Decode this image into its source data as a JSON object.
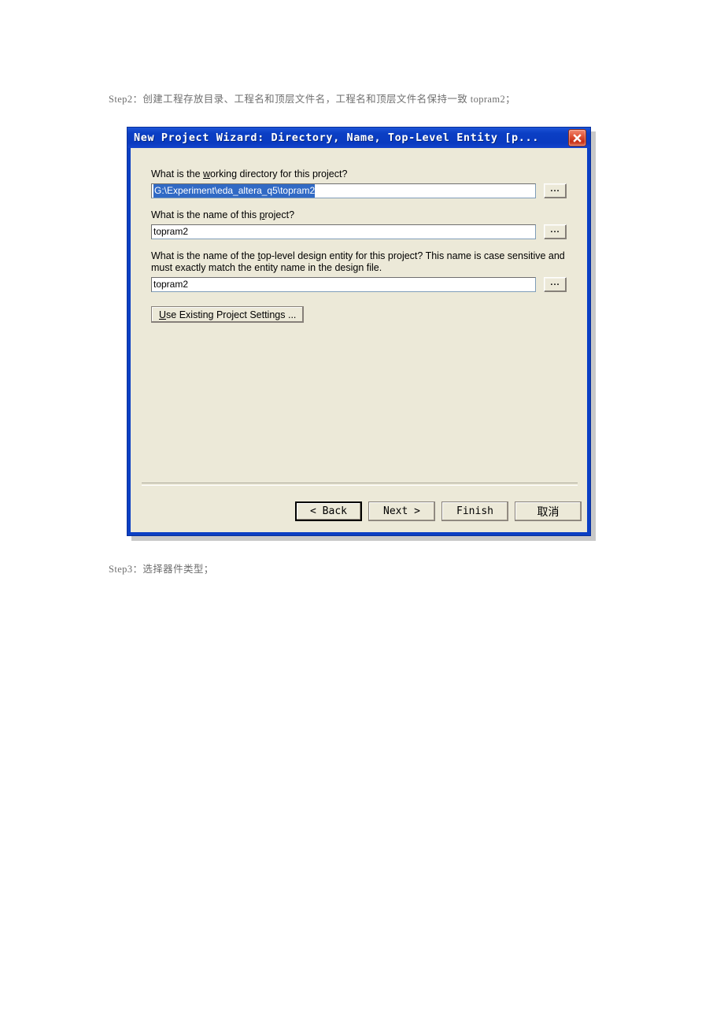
{
  "document": {
    "step2_text": "Step2：创建工程存放目录、工程名和顶层文件名，工程名和顶层文件名保持一致 topram2；",
    "step3_text": "Step3：选择器件类型；"
  },
  "dialog": {
    "title": "New Project Wizard: Directory, Name, Top-Level Entity [p...",
    "close_label": "×",
    "colors": {
      "titlebar": "#0b3fc4",
      "client": "#ece9d8",
      "selection": "#316ac5",
      "close_button": "#c62f16"
    },
    "fields": [
      {
        "label_before": "What is the ",
        "label_accel": "w",
        "label_after": "orking directory for this project?",
        "value": "G:\\Experiment\\eda_altera_q5\\topram2",
        "selected": true,
        "browse_label": "..."
      },
      {
        "label_before": "What is the name of this ",
        "label_accel": "p",
        "label_after": "roject?",
        "value": "topram2",
        "selected": false,
        "browse_label": "..."
      },
      {
        "label_before": "What is the name of the ",
        "label_accel": "t",
        "label_after": "op-level design entity for this project? This name is case sensitive and must exactly match the entity name in the design file.",
        "value": "topram2",
        "selected": false,
        "browse_label": "..."
      }
    ],
    "settings_button": {
      "accel": "U",
      "text": "se Existing Project Settin",
      "accel2": "g",
      "text2": "s ..."
    },
    "footer_buttons": [
      {
        "label": "< Back",
        "focused": true,
        "cjk": false
      },
      {
        "label": "Next >",
        "focused": false,
        "cjk": false
      },
      {
        "label": "Finish",
        "focused": false,
        "cjk": false
      },
      {
        "label": "取消",
        "focused": false,
        "cjk": true
      }
    ]
  }
}
